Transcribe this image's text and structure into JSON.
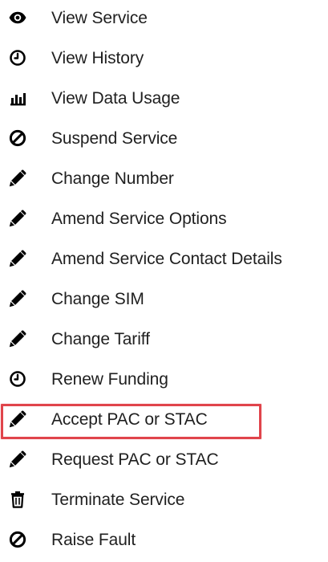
{
  "colors": {
    "text": "#1f1f1f",
    "icon": "#000000",
    "highlight": "#e0444b"
  },
  "menu": {
    "items": [
      {
        "label": "View Service",
        "icon": "eye-icon"
      },
      {
        "label": "View History",
        "icon": "clock-icon"
      },
      {
        "label": "View Data Usage",
        "icon": "bar-chart-icon"
      },
      {
        "label": "Suspend Service",
        "icon": "ban-icon"
      },
      {
        "label": "Change Number",
        "icon": "pencil-icon"
      },
      {
        "label": "Amend Service Options",
        "icon": "pencil-icon"
      },
      {
        "label": "Amend Service Contact Details",
        "icon": "pencil-icon"
      },
      {
        "label": "Change SIM",
        "icon": "pencil-icon"
      },
      {
        "label": "Change Tariff",
        "icon": "pencil-icon"
      },
      {
        "label": "Renew Funding",
        "icon": "clock-icon"
      },
      {
        "label": "Accept PAC or STAC",
        "icon": "pencil-icon",
        "highlighted": true
      },
      {
        "label": "Request PAC or STAC",
        "icon": "pencil-icon"
      },
      {
        "label": "Terminate Service",
        "icon": "trash-icon"
      },
      {
        "label": "Raise Fault",
        "icon": "ban-icon"
      }
    ]
  }
}
